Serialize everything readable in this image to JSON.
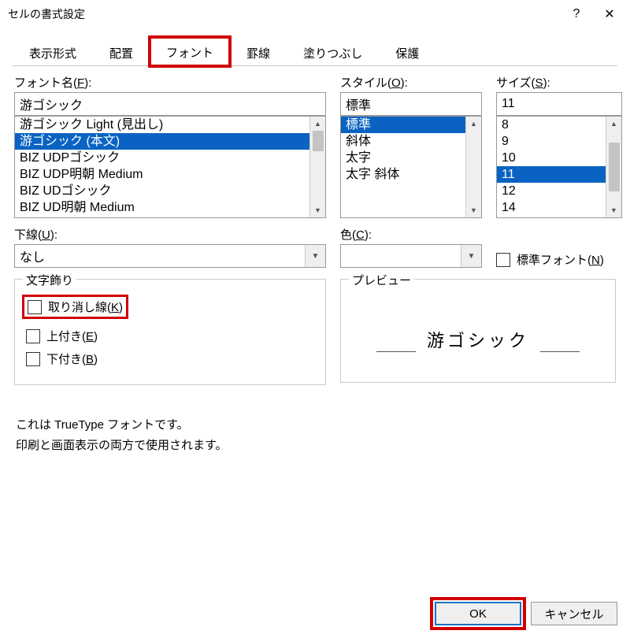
{
  "dialog_title": "セルの書式設定",
  "titlebar": {
    "help_icon": "?",
    "close_icon": "✕"
  },
  "tabs": [
    "表示形式",
    "配置",
    "フォント",
    "罫線",
    "塗りつぶし",
    "保護"
  ],
  "active_tab_index": 2,
  "labels": {
    "font_name_pre": "フォント名(",
    "font_name_u": "F",
    "font_name_post": "):",
    "style_pre": "スタイル(",
    "style_u": "O",
    "style_post": "):",
    "size_pre": "サイズ(",
    "size_u": "S",
    "size_post": "):",
    "underline_pre": "下線(",
    "underline_u": "U",
    "underline_post": "):",
    "color_pre": "色(",
    "color_u": "C",
    "color_post": "):"
  },
  "font_name": {
    "value": "游ゴシック",
    "items": [
      "游ゴシック Light (見出し)",
      "游ゴシック (本文)",
      "BIZ UDPゴシック",
      "BIZ UDP明朝 Medium",
      "BIZ UDゴシック",
      "BIZ UD明朝 Medium"
    ],
    "selected_index": 1
  },
  "style": {
    "value": "標準",
    "items": [
      "標準",
      "斜体",
      "太字",
      "太字 斜体"
    ],
    "selected_index": 0
  },
  "size": {
    "value": "11",
    "items": [
      "8",
      "9",
      "10",
      "11",
      "12",
      "14"
    ],
    "selected_index": 3
  },
  "underline": {
    "value": "なし"
  },
  "normal_font": {
    "pre": "標準フォント(",
    "u": "N",
    "post": ")"
  },
  "effects": {
    "legend": "文字飾り",
    "strikethrough_pre": "取り消し線(",
    "strikethrough_u": "K",
    "strikethrough_post": ")",
    "superscript_pre": "上付き(",
    "superscript_u": "E",
    "superscript_post": ")",
    "subscript_pre": "下付き(",
    "subscript_u": "B",
    "subscript_post": ")"
  },
  "preview": {
    "legend": "プレビュー",
    "text": "游ゴシック"
  },
  "foot1": "これは TrueType フォントです。",
  "foot2": "印刷と画面表示の両方で使用されます。",
  "buttons": {
    "ok": "OK",
    "cancel": "キャンセル"
  }
}
